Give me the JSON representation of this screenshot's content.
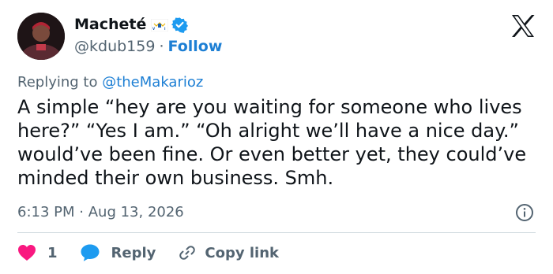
{
  "tweet": {
    "author_name": "Macheté",
    "author_handle": "@kdub159",
    "separator": "·",
    "follow_label": "Follow",
    "replying_prefix": "Replying to",
    "replying_to": "@theMakarioz",
    "text": "A simple “hey are you waiting for someone who lives here?” “Yes I am.” “Oh alright we’ll have a nice day.” would’ve been fine. Or even better yet, they could’ve minded their own business. Smh.",
    "time": "6:13 PM",
    "date": "Aug 13, 2026",
    "time_separator": "·"
  },
  "actions": {
    "like_count": "1",
    "reply_label": "Reply",
    "copy_label": "Copy link"
  },
  "icons": {
    "flag": "us-virgin-islands-flag-icon",
    "verified": "verified-badge-icon",
    "logo": "x-logo-icon",
    "info": "info-icon",
    "like": "heart-icon",
    "reply": "speech-bubble-icon",
    "copy": "link-icon"
  },
  "colors": {
    "text": "#0f1419",
    "muted": "#536471",
    "link": "#1d7fd4",
    "verified": "#1d9bf0",
    "heart": "#f91880",
    "divider": "#cfd9de"
  }
}
